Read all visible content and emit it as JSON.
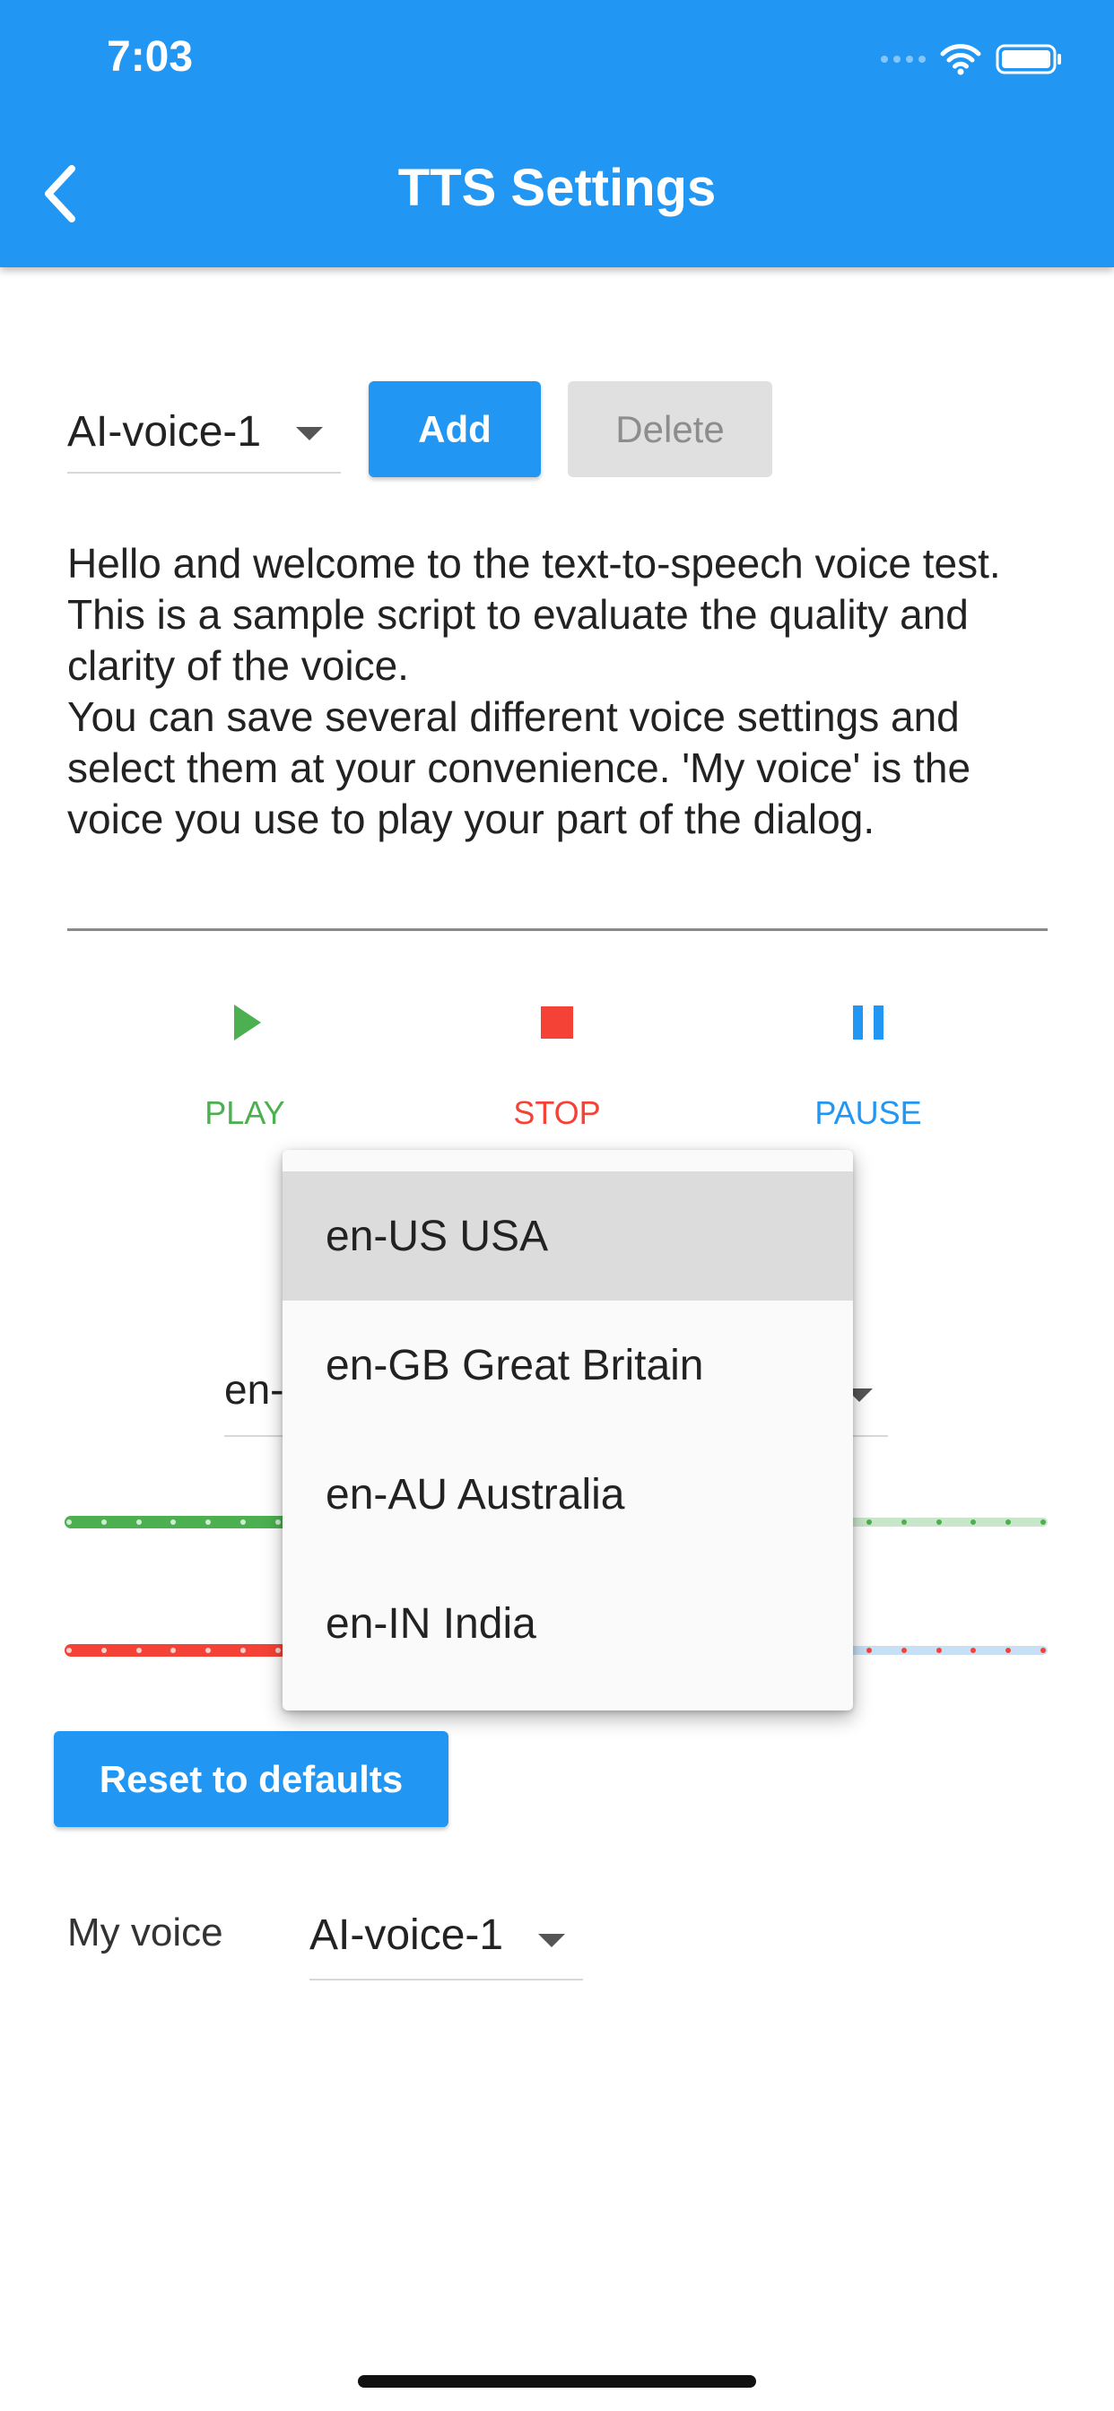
{
  "status_bar": {
    "time": "7:03"
  },
  "app_bar": {
    "title": "TTS Settings"
  },
  "voice_profile": {
    "selected": "AI-voice-1",
    "add_label": "Add",
    "delete_label": "Delete"
  },
  "sample_text": "Hello and welcome to the text-to-speech voice test. This is a sample script to evaluate the quality and clarity of the voice.\nYou can save several different voice settings and select them at your convenience. 'My voice' is the voice you use to play your part of the dialog.",
  "controls": {
    "play_label": "PLAY",
    "stop_label": "STOP",
    "pause_label": "PAUSE"
  },
  "language": {
    "selected_partial": "en-",
    "options": [
      "en-US USA",
      "en-GB Great Britain",
      "en-AU Australia",
      "en-IN India"
    ],
    "highlighted": "en-US USA"
  },
  "sliders": [
    {
      "name": "green-slider",
      "active_color": "#4CAF50",
      "inactive_color": "#C8E6C9"
    },
    {
      "name": "red-slider",
      "active_color": "#F44336",
      "inactive_color": "#C7E0F5"
    }
  ],
  "reset_label": "Reset to defaults",
  "my_voice": {
    "label": "My voice",
    "selected": "AI-voice-1"
  },
  "colors": {
    "primary": "#2196F3",
    "play": "#4CAF50",
    "stop": "#F44336",
    "pause": "#2196F3"
  }
}
